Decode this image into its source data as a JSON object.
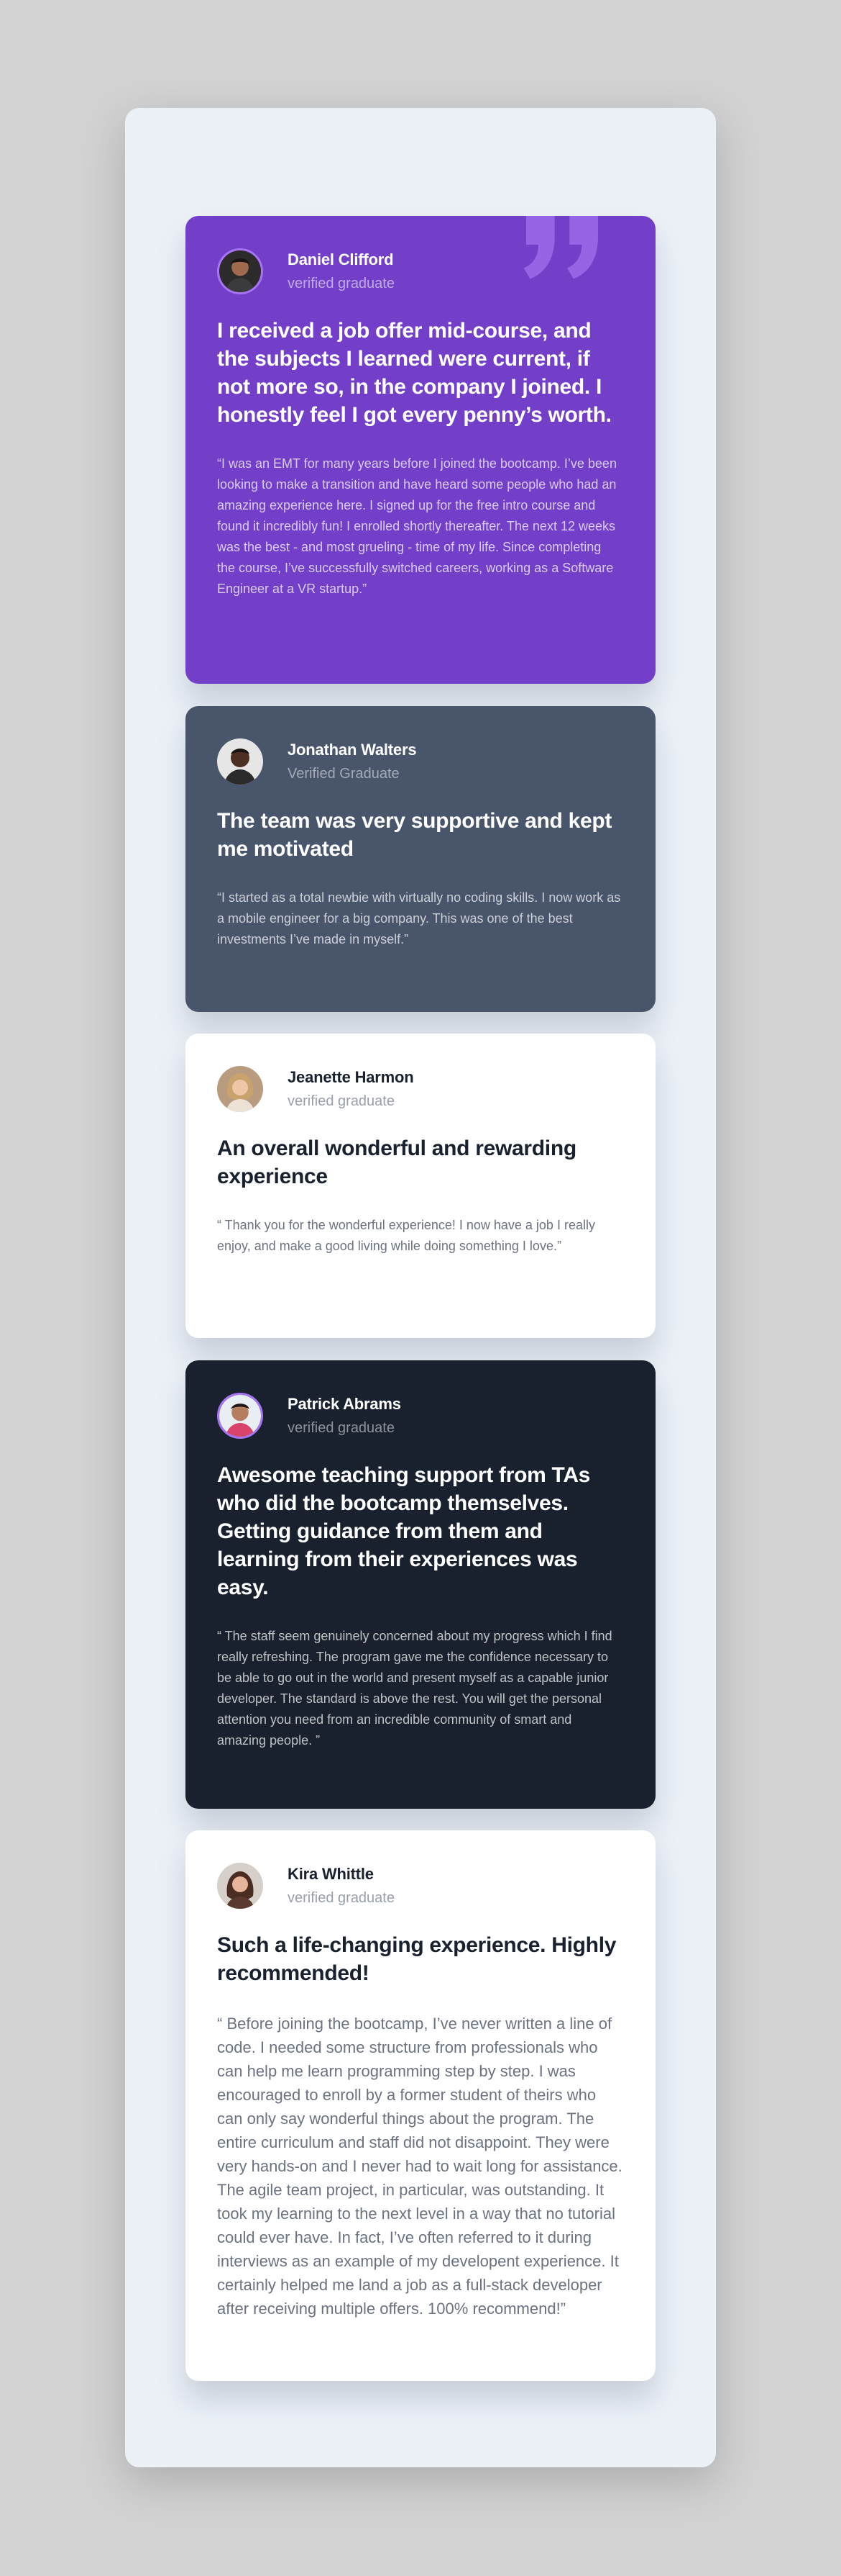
{
  "testimonials": [
    {
      "name": "Daniel Clifford",
      "role": "verified graduate",
      "title": "I received a job offer mid-course, and the subjects I learned were current, if not more so, in the company I joined. I honestly feel I got every penny’s worth.",
      "quote": "“I was an EMT for many years before I joined the bootcamp. I’ve been looking to make a transition and have heard some people who had an amazing experience here. I signed up for the free intro course and found it incredibly fun! I enrolled shortly thereafter. The next 12 weeks was the best - and most grueling - time of my life. Since completing the course, I’ve successfully switched careers, working as a Software Engineer at a VR startup.”",
      "avatar_icon": "avatar-daniel-icon"
    },
    {
      "name": "Jonathan Walters",
      "role": "Verified Graduate",
      "title": "The team was very supportive and kept me motivated",
      "quote": "“I started as a total newbie with virtually no coding skills. I now work as a mobile engineer for a big company. This was one of the best investments I’ve made in myself.”",
      "avatar_icon": "avatar-jonathan-icon"
    },
    {
      "name": "Jeanette Harmon",
      "role": "verified graduate",
      "title": "An overall wonderful and rewarding experience",
      "quote": "“ Thank you for the wonderful experience! I now have a job I really enjoy, and make a good living while doing something I love.”",
      "avatar_icon": "avatar-jeanette-icon"
    },
    {
      "name": "Patrick Abrams",
      "role": "verified graduate",
      "title": "Awesome teaching support from TAs who did the bootcamp themselves. Getting guidance from them and learning from their experiences was easy.",
      "quote": "“ The staff seem genuinely concerned about my progress which I find really refreshing. The program gave me the confidence necessary to be able to go out in the world and present myself as a capable junior developer. The standard is above the rest. You will get the personal attention you need from an incredible community of smart and amazing people. ”",
      "avatar_icon": "avatar-patrick-icon"
    },
    {
      "name": "Kira Whittle",
      "role": "verified graduate",
      "title": "Such a life-changing experience. Highly recommended!",
      "quote": "“ Before joining the bootcamp, I’ve never written a line of code. I needed some structure from professionals who can help me learn programming step by step. I was encouraged to enroll by a former student of theirs who can only say wonderful things about the program. The entire curriculum and staff did not disappoint. They were very hands-on and I never had to wait long for assistance. The agile team project, in particular, was outstanding. It took my learning to the next level in a way that no tutorial could ever have. In fact, I’ve often referred to it during interviews as an example of my developent experience. It certainly helped me land a job as a full-stack developer after receiving multiple offers. 100% recommend!”",
      "avatar_icon": "avatar-kira-icon"
    }
  ],
  "colors": {
    "page_bg": "#d2d2d2",
    "frame_bg": "#ecf1f8",
    "purple": "#733fc8",
    "grayish_blue": "#48556a",
    "dark_blackish_blue": "#19212e",
    "white": "#ffffff",
    "avatar_border": "#a775f1"
  },
  "decor": {
    "quote_icon": "quotation-mark-icon"
  }
}
